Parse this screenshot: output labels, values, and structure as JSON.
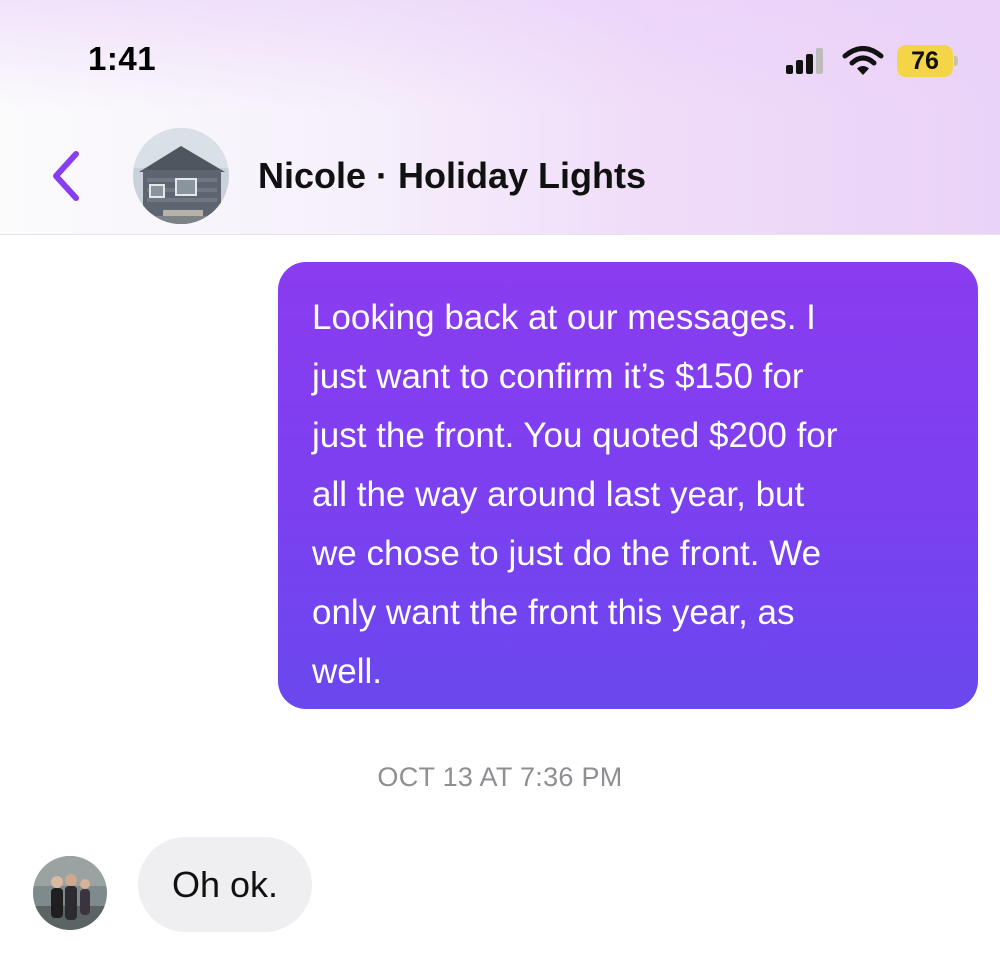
{
  "status_bar": {
    "time": "1:41",
    "battery_level": "76",
    "signal_icon": "cellular-signal-icon",
    "wifi_icon": "wifi-icon",
    "battery_icon": "battery-icon"
  },
  "header": {
    "back_icon": "chevron-left-icon",
    "avatar_icon": "house-avatar",
    "title": "Nicole · Holiday Lights"
  },
  "messages": [
    {
      "direction": "outgoing",
      "text": "Looking back at our messages. I\njust want to confirm it’s $150 for\njust the front. You quoted $200 for\nall the way around last year, but\nwe chose to just do the front. We\nonly want the front this year, as\nwell."
    },
    {
      "direction": "incoming",
      "text": "Oh ok."
    }
  ],
  "timestamp": "OCT 13 AT 7:36 PM",
  "colors": {
    "accent": "#8a3cf0",
    "bubble_gradient_end": "#6a48ee",
    "incoming_bubble": "#efeff1",
    "timestamp_text": "#8e8e93",
    "battery_fill": "#f5d548"
  }
}
